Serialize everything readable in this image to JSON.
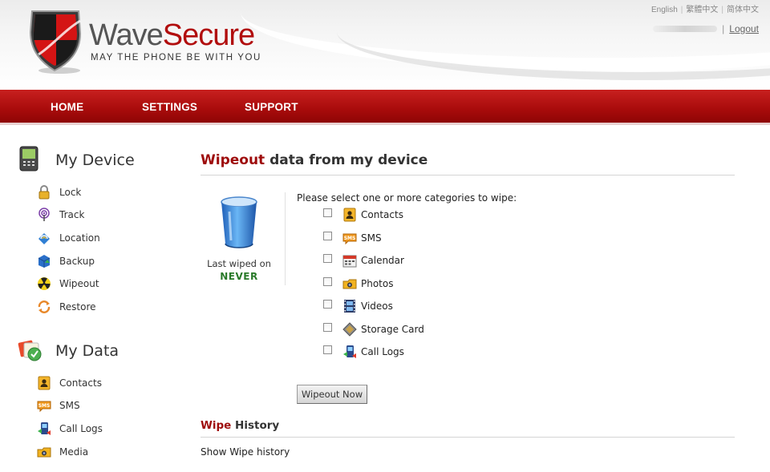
{
  "header": {
    "brand_part1": "Wave",
    "brand_part2": "Secure",
    "tagline": "MAY THE PHONE BE WITH YOU",
    "languages": [
      "English",
      "繁體中文",
      "简体中文"
    ],
    "logout_label": "Logout",
    "separator": "|"
  },
  "nav": {
    "items": [
      {
        "label": "HOME"
      },
      {
        "label": "SETTINGS"
      },
      {
        "label": "SUPPORT"
      }
    ]
  },
  "sidebar": {
    "device_title": "My Device",
    "device_items": [
      {
        "label": "Lock",
        "icon": "lock-icon"
      },
      {
        "label": "Track",
        "icon": "track-icon"
      },
      {
        "label": "Location",
        "icon": "location-icon"
      },
      {
        "label": "Backup",
        "icon": "backup-icon"
      },
      {
        "label": "Wipeout",
        "icon": "wipeout-icon"
      },
      {
        "label": "Restore",
        "icon": "restore-icon"
      }
    ],
    "data_title": "My Data",
    "data_items": [
      {
        "label": "Contacts",
        "icon": "contacts-icon"
      },
      {
        "label": "SMS",
        "icon": "sms-icon"
      },
      {
        "label": "Call Logs",
        "icon": "call-logs-icon"
      },
      {
        "label": "Media",
        "icon": "media-icon"
      }
    ]
  },
  "main": {
    "title_highlight": "Wipeout",
    "title_rest": " data from my device",
    "last_wiped_label": "Last wiped on",
    "last_wiped_value": "NEVER",
    "prompt": "Please select one or more categories to wipe:",
    "categories": [
      {
        "label": "Contacts",
        "checked": false
      },
      {
        "label": "SMS",
        "checked": false
      },
      {
        "label": "Calendar",
        "checked": false
      },
      {
        "label": "Photos",
        "checked": false
      },
      {
        "label": "Videos",
        "checked": false
      },
      {
        "label": "Storage Card",
        "checked": false
      },
      {
        "label": "Call Logs",
        "checked": false
      }
    ],
    "wipe_button": "Wipeout Now",
    "history_highlight": "Wipe",
    "history_rest": " History",
    "show_history": "Show Wipe history"
  },
  "colors": {
    "brand_red": "#b10d0d",
    "nav_red": "#a80b0b",
    "never_green": "#2a7a2a"
  }
}
